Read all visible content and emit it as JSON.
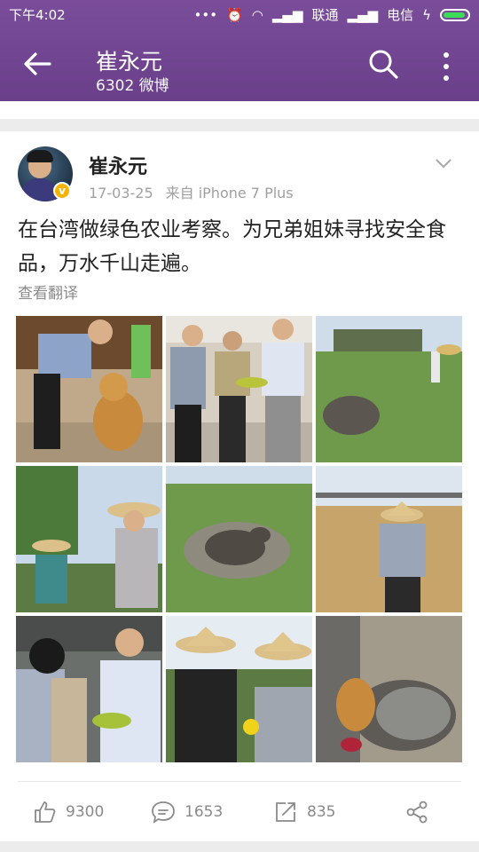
{
  "status": {
    "time": "下午4:02",
    "carrier1": "联通",
    "carrier2": "电信"
  },
  "header": {
    "title": "崔永元",
    "subtitle": "6302 微博"
  },
  "post": {
    "author": "崔永元",
    "date": "17-03-25",
    "source": "来自 iPhone 7 Plus",
    "text": "在台湾做绿色农业考察。为兄弟姐妹寻找安全食品，万水千山走遍。",
    "translate": "查看翻译",
    "photos": [
      "photo-man-petting-dog",
      "photo-group-inspecting-produce",
      "photo-water-buffalo-in-field",
      "photo-people-in-straw-hats",
      "photo-buffalo-in-mud-pond",
      "photo-man-in-straw-hat-in-field",
      "photo-men-examining-vegetables",
      "photo-straw-hats-holding-lemon",
      "photo-roosters"
    ]
  },
  "actions": {
    "likes": "9300",
    "comments": "1653",
    "reposts": "835"
  },
  "colors": {
    "header": "#6a3f8a",
    "badge": "#f6b400"
  }
}
